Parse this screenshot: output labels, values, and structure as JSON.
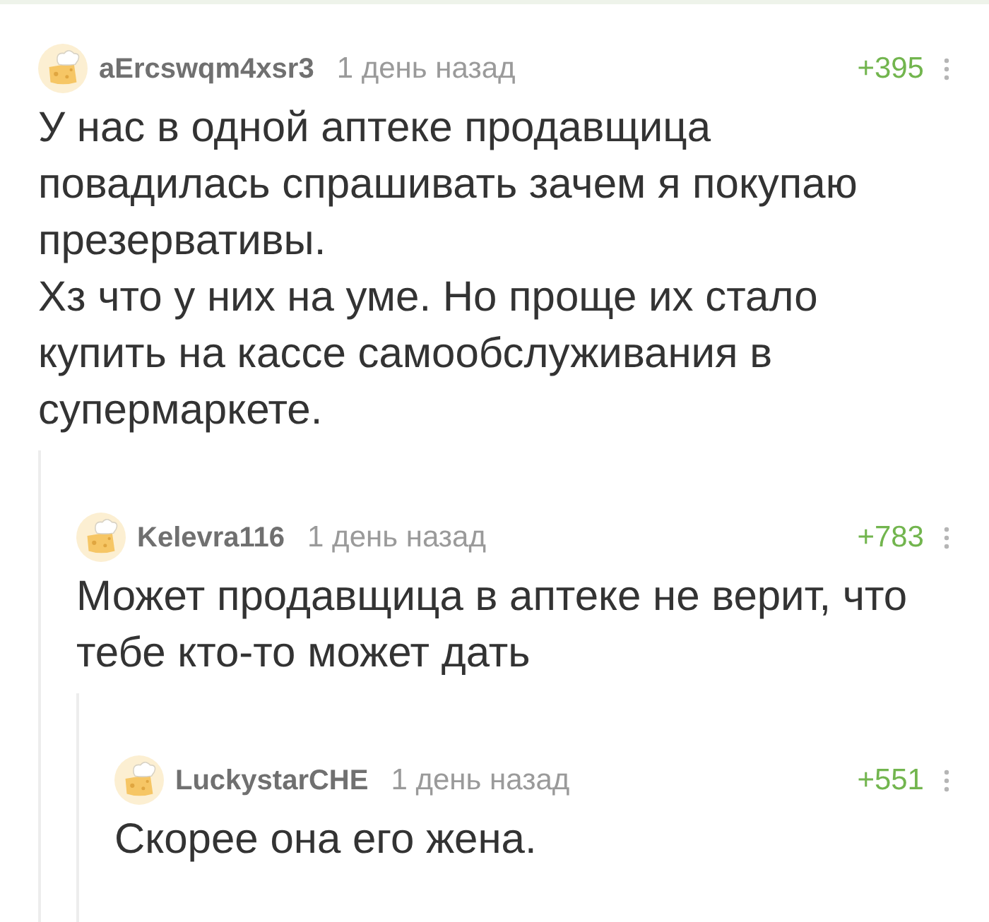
{
  "comments": [
    {
      "author": "aErcswqm4xsr3",
      "time": "1 день назад",
      "score": "+395",
      "text": [
        "У нас в одной аптеке продавщица повадилась спрашивать зачем я покупаю презервативы.",
        "Хз что у них на уме. Но проще их стало купить на кассе самообслуживания в супермаркете."
      ],
      "children": [
        {
          "author": "Kelevra116",
          "time": "1 день назад",
          "score": "+783",
          "text": [
            "Может продавщица в аптеке не верит, что тебе кто-то может дать"
          ],
          "children": [
            {
              "author": "LuckystarCHE",
              "time": "1 день назад",
              "score": "+551",
              "text": [
                "Скорее она его жена."
              ]
            }
          ]
        }
      ]
    }
  ]
}
